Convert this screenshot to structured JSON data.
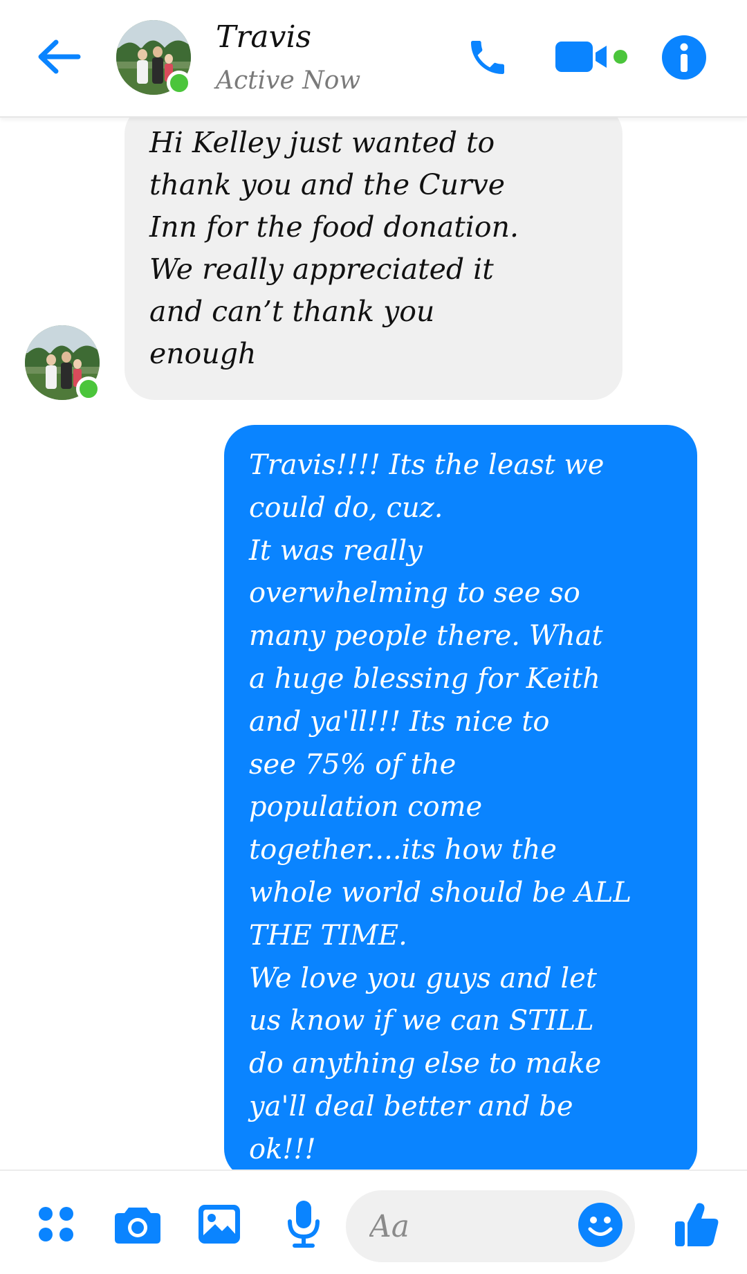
{
  "header": {
    "contact_name": "Travis",
    "status": "Active Now",
    "icons": {
      "back": "arrow-left-icon",
      "call": "phone-icon",
      "video": "video-camera-icon",
      "info": "info-icon"
    }
  },
  "messages": [
    {
      "direction": "incoming",
      "text": "Hi Kelley just wanted to\nthank you and the Curve\nInn for the food donation.\nWe really appreciated it\nand can’t thank you\nenough"
    },
    {
      "direction": "outgoing",
      "text": "Travis!!!! Its the least we\ncould do, cuz.\nIt was really\noverwhelming to see so\nmany people there. What\na huge blessing for Keith\nand ya'll!!! Its nice to\nsee 75% of the\npopulation come\ntogether....its how the\nwhole world should be ALL\nTHE TIME.\nWe love you guys and let\nus know if we can STILL\ndo anything else to make\nya'll deal better and be\nok!!!"
    }
  ],
  "composer": {
    "placeholder": "Aa",
    "icons": {
      "menu": "four-dots-icon",
      "camera": "camera-icon",
      "gallery": "image-icon",
      "mic": "microphone-icon",
      "emoji": "smiley-icon",
      "like": "thumbs-up-icon"
    }
  },
  "colors": {
    "accent": "#0a84ff",
    "online": "#4bc53b",
    "incoming_bubble": "#f0f0f0",
    "outgoing_bubble": "#0a84ff"
  }
}
